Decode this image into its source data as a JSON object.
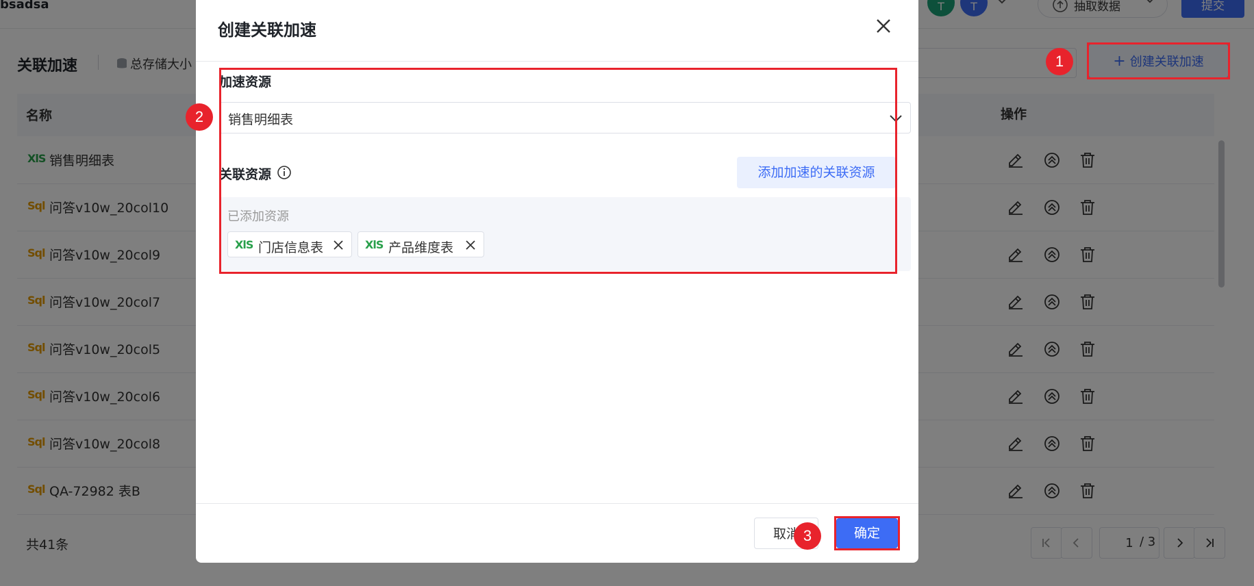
{
  "page": {
    "title": "bsadsa",
    "avatars": [
      {
        "letter": "T",
        "color": "#1aa177"
      },
      {
        "letter": "T",
        "color": "#3d6cf5"
      }
    ],
    "extract_label": "抽取数据",
    "submit_label": "提交"
  },
  "section": {
    "title": "关联加速",
    "storage_label": "总存储大小",
    "create_button": "创建关联加速"
  },
  "table": {
    "columns": {
      "name": "名称",
      "ops": "操作"
    },
    "rows": [
      {
        "type": "xls",
        "type_label": "XlS",
        "name": "销售明细表"
      },
      {
        "type": "sql",
        "type_label": "Sql",
        "name": "问答v10w_20col10"
      },
      {
        "type": "sql",
        "type_label": "Sql",
        "name": "问答v10w_20col9"
      },
      {
        "type": "sql",
        "type_label": "Sql",
        "name": "问答v10w_20col7"
      },
      {
        "type": "sql",
        "type_label": "Sql",
        "name": "问答v10w_20col5"
      },
      {
        "type": "sql",
        "type_label": "Sql",
        "name": "问答v10w_20col6"
      },
      {
        "type": "sql",
        "type_label": "Sql",
        "name": "问答v10w_20col8"
      },
      {
        "type": "sql",
        "type_label": "Sql",
        "name": "QA-72982 表B"
      }
    ],
    "total": "共41条"
  },
  "pagination": {
    "current": "1",
    "total": "/ 3"
  },
  "modal": {
    "title": "创建关联加速",
    "accel_label": "加速资源",
    "accel_value": "销售明细表",
    "rel_label": "关联资源",
    "add_rel_button": "添加加速的关联资源",
    "added_title": "已添加资源",
    "tags": [
      {
        "type_label": "XlS",
        "name": "门店信息表"
      },
      {
        "type_label": "XlS",
        "name": "产品维度表"
      }
    ],
    "cancel": "取消",
    "ok": "确定"
  },
  "annotations": {
    "step1": "1",
    "step2": "2",
    "step3": "3"
  },
  "colors": {
    "primary": "#3d6cf5",
    "annotation_red": "#e8232c",
    "xls_green": "#29a04b",
    "sql_orange": "#e59b00"
  },
  "icons": [
    "close-icon",
    "chevron-down-icon",
    "info-icon",
    "edit-icon",
    "accelerate-icon",
    "trash-icon",
    "plus-icon",
    "database-icon",
    "first-page-icon",
    "prev-page-icon",
    "next-page-icon",
    "last-page-icon"
  ]
}
